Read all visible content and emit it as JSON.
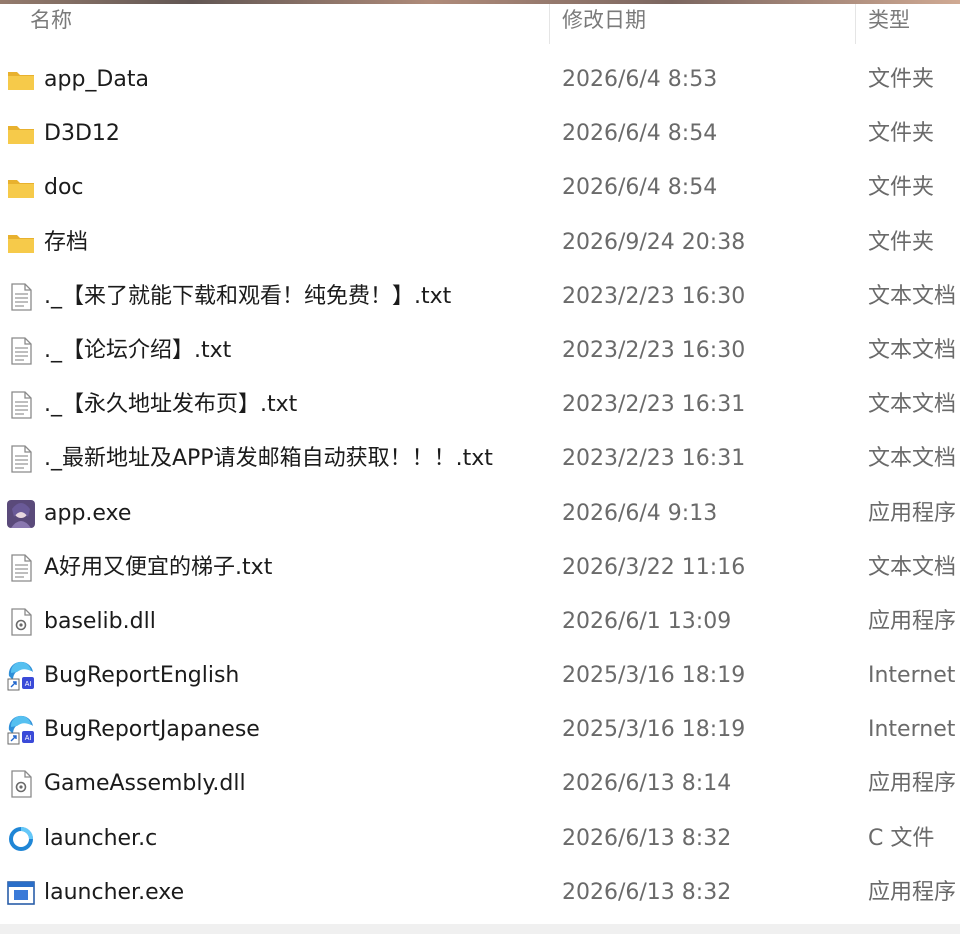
{
  "columns": {
    "name": "名称",
    "date": "修改日期",
    "type": "类型"
  },
  "colors": {
    "folder": "#f4c542",
    "text_primary": "#1b1b1b",
    "text_secondary": "#6a6a6a",
    "header_text": "#7a7a7a"
  },
  "files": [
    {
      "name": "app_Data",
      "date": "2026/6/4 8:53",
      "type": "文件夹",
      "icon": "folder-icon"
    },
    {
      "name": "D3D12",
      "date": "2026/6/4 8:54",
      "type": "文件夹",
      "icon": "folder-icon"
    },
    {
      "name": "doc",
      "date": "2026/6/4 8:54",
      "type": "文件夹",
      "icon": "folder-icon"
    },
    {
      "name": "存档",
      "date": "2026/9/24 20:38",
      "type": "文件夹",
      "icon": "folder-icon"
    },
    {
      "name": "._【来了就能下载和观看！纯免费！】.txt",
      "date": "2023/2/23 16:30",
      "type": "文本文档",
      "icon": "text-file-icon"
    },
    {
      "name": "._【论坛介绍】.txt",
      "date": "2023/2/23 16:30",
      "type": "文本文档",
      "icon": "text-file-icon"
    },
    {
      "name": "._【永久地址发布页】.txt",
      "date": "2023/2/23 16:31",
      "type": "文本文档",
      "icon": "text-file-icon"
    },
    {
      "name": "._最新地址及APP请发邮箱自动获取！！！.txt",
      "date": "2023/2/23 16:31",
      "type": "文本文档",
      "icon": "text-file-icon"
    },
    {
      "name": "app.exe",
      "date": "2026/6/4 9:13",
      "type": "应用程序",
      "icon": "app-exe-icon"
    },
    {
      "name": "A好用又便宜的梯子.txt",
      "date": "2026/3/22 11:16",
      "type": "文本文档",
      "icon": "text-file-icon"
    },
    {
      "name": "baselib.dll",
      "date": "2026/6/1 13:09",
      "type": "应用程序",
      "icon": "dll-file-icon"
    },
    {
      "name": "BugReportEnglish",
      "date": "2025/3/16 18:19",
      "type": "Internet",
      "icon": "internet-shortcut-icon"
    },
    {
      "name": "BugReportJapanese",
      "date": "2025/3/16 18:19",
      "type": "Internet",
      "icon": "internet-shortcut-icon"
    },
    {
      "name": "GameAssembly.dll",
      "date": "2026/6/13 8:14",
      "type": "应用程序",
      "icon": "dll-file-icon"
    },
    {
      "name": "launcher.c",
      "date": "2026/6/13 8:32",
      "type": "C 文件",
      "icon": "c-source-file-icon"
    },
    {
      "name": "launcher.exe",
      "date": "2026/6/13 8:32",
      "type": "应用程序",
      "icon": "window-exe-icon"
    }
  ]
}
